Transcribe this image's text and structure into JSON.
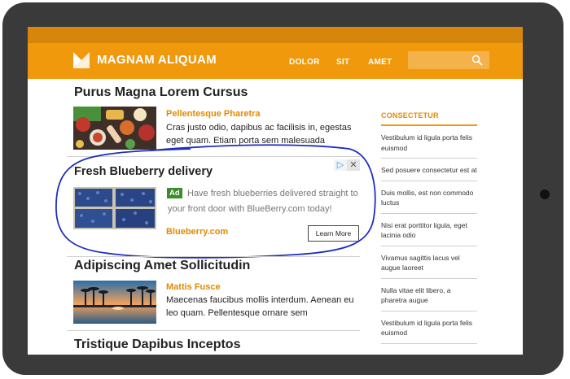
{
  "header": {
    "logo_text": "MAGNAM ALIQUAM",
    "nav": [
      "DOLOR",
      "SIT",
      "AMET"
    ],
    "search_placeholder": ""
  },
  "main": {
    "sections": [
      {
        "heading": "Purus Magna Lorem Cursus",
        "article_title": "Pellentesque Pharetra",
        "article_body": "Cras justo odio, dapibus ac facilisis in, egestas eget quam. Etiam porta sem malesuada"
      },
      {
        "heading": "Adipiscing Amet Sollicitudin",
        "article_title": "Mattis Fusce",
        "article_body": "Maecenas faucibus mollis interdum. Aenean eu leo quam. Pellentesque ornare sem"
      },
      {
        "heading": "Tristique Dapibus Inceptos"
      }
    ],
    "ad": {
      "title": "Fresh Blueberry delivery",
      "badge": "Ad",
      "text": "Have fresh blueberries delivered straight to your front door with BlueBerry.com today!",
      "domain": "Blueberry.com",
      "button": "Learn More",
      "adchoices_icon": "▷",
      "close_icon": "✕"
    }
  },
  "sidebar": {
    "heading": "CONSECTETUR",
    "items": [
      "Vestibulum id ligula porta felis euismod",
      "Sed posuere consectetur est at",
      "Duis mollis, est non commodo luctus",
      "Nisi erat porttitor ligula, eget lacinia odio",
      "Vivamus sagittis lacus vel augue laoreet",
      "Nulla vitae elit libero, a pharetra augue",
      "Vestibulum id ligula porta felis euismod"
    ]
  },
  "colors": {
    "brand_orange": "#f0990c",
    "topbar_orange": "#d6860b",
    "link_orange": "#e08a00",
    "annotation_blue": "#1f2fbf"
  }
}
